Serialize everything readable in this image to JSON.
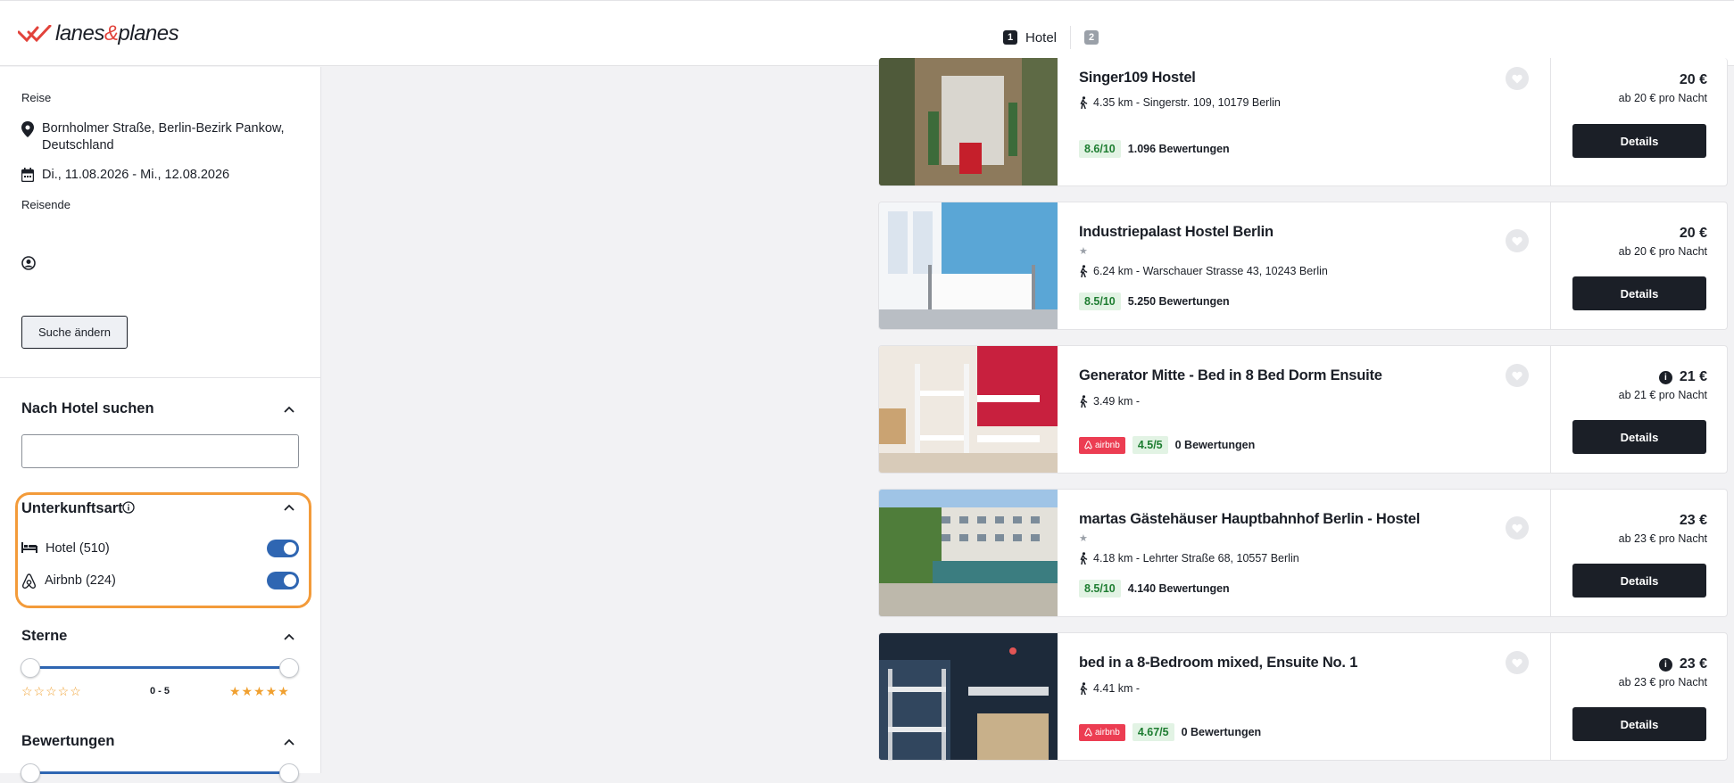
{
  "header": {
    "logo": {
      "brand_left": "lanes",
      "amp": "&",
      "brand_right": "planes"
    },
    "steps": [
      {
        "number": "1",
        "label": "Hotel"
      },
      {
        "number": "2",
        "label": ""
      }
    ]
  },
  "sidebar": {
    "trip_label": "Reise",
    "location": "Bornholmer Straße, Berlin-Bezirk Pankow, Deutschland",
    "dates": "Di., 11.08.2026 - Mi., 12.08.2026",
    "travelers_label": "Reisende",
    "change_search_button": "Suche ändern",
    "hotel_search": {
      "title": "Nach Hotel suchen",
      "value": "",
      "placeholder": ""
    },
    "accommodation": {
      "title": "Unterkunftsart",
      "options": [
        {
          "label": "Hotel (510)",
          "enabled": true
        },
        {
          "label": "Airbnb (224)",
          "enabled": true
        }
      ]
    },
    "stars": {
      "title": "Sterne",
      "range_label": "0 - 5",
      "min": 0,
      "max": 5,
      "empty_stars": "☆☆☆☆☆",
      "full_stars": "★★★★★"
    },
    "reviews": {
      "title": "Bewertungen"
    }
  },
  "results": [
    {
      "name": "Singer109 Hostel",
      "stars": "",
      "distance": "4.35 km - Singerstr. 109, 10179 Berlin",
      "airbnb": false,
      "airbnb_label": "",
      "rating": "8.6/10",
      "reviews": "1.096 Bewertungen",
      "price": "20 €",
      "price_info": false,
      "per_night": "ab 20 € pro Nacht",
      "details_label": "Details"
    },
    {
      "name": "Industriepalast Hostel Berlin",
      "stars": "★",
      "distance": "6.24 km - Warschauer Strasse 43, 10243 Berlin",
      "airbnb": false,
      "airbnb_label": "",
      "rating": "8.5/10",
      "reviews": "5.250 Bewertungen",
      "price": "20 €",
      "price_info": false,
      "per_night": "ab 20 € pro Nacht",
      "details_label": "Details"
    },
    {
      "name": "Generator Mitte - Bed in 8 Bed Dorm Ensuite",
      "stars": "",
      "distance": "3.49 km -",
      "airbnb": true,
      "airbnb_label": "airbnb",
      "rating": "4.5/5",
      "reviews": "0 Bewertungen",
      "price": "21 €",
      "price_info": true,
      "per_night": "ab 21 € pro Nacht",
      "details_label": "Details"
    },
    {
      "name": "martas Gästehäuser Hauptbahnhof Berlin - Hostel",
      "stars": "★",
      "distance": "4.18 km - Lehrter Straße 68, 10557 Berlin",
      "airbnb": false,
      "airbnb_label": "",
      "rating": "8.5/10",
      "reviews": "4.140 Bewertungen",
      "price": "23 €",
      "price_info": false,
      "per_night": "ab 23 € pro Nacht",
      "details_label": "Details"
    },
    {
      "name": "bed in a 8-Bedroom mixed, Ensuite No. 1",
      "stars": "",
      "distance": "4.41 km -",
      "airbnb": true,
      "airbnb_label": "airbnb",
      "rating": "4.67/5",
      "reviews": "0 Bewertungen",
      "price": "23 €",
      "price_info": true,
      "per_night": "ab 23 € pro Nacht",
      "details_label": "Details"
    }
  ],
  "colors": {
    "accent": "#2f66b2",
    "highlight": "#f39b3a",
    "airbnb": "#ec3d52",
    "rating_text": "#1e7d31",
    "rating_bg": "#e2f3e4",
    "dark": "#1b1f27"
  }
}
